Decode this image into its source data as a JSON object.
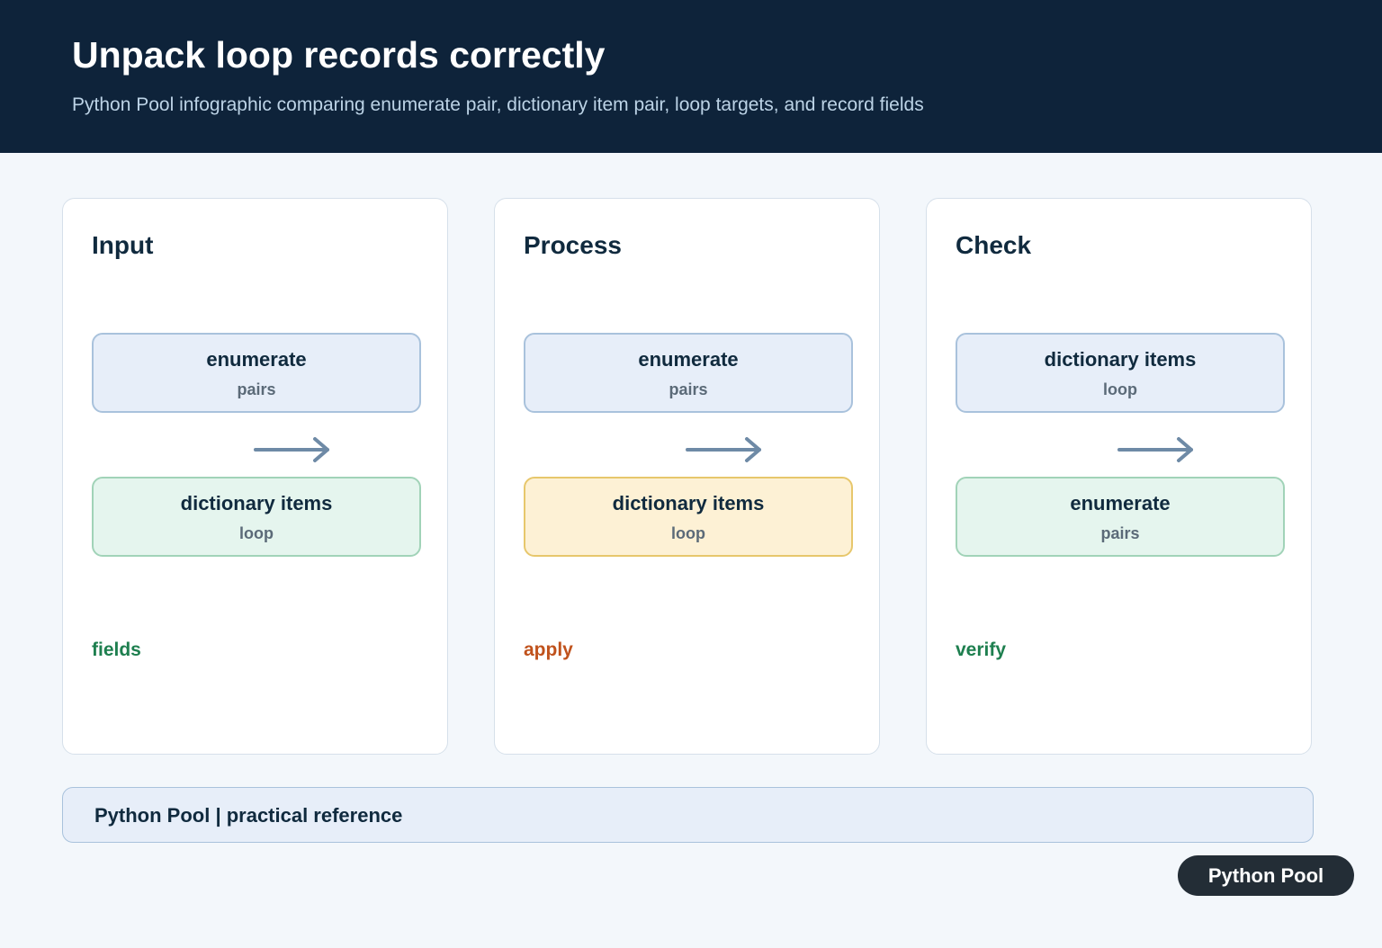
{
  "header": {
    "title": "Unpack loop records correctly",
    "subtitle": "Python Pool infographic comparing enumerate pair, dictionary item pair, loop targets, and record fields"
  },
  "panels": [
    {
      "title": "Input",
      "top_box": {
        "label": "enumerate",
        "sub": "pairs",
        "style": "blue"
      },
      "bottom_box": {
        "label": "dictionary items",
        "sub": "loop",
        "style": "green"
      },
      "step_label": "fields",
      "step_color": "#1e7f4f"
    },
    {
      "title": "Process",
      "top_box": {
        "label": "enumerate",
        "sub": "pairs",
        "style": "blue"
      },
      "bottom_box": {
        "label": "dictionary items",
        "sub": "loop",
        "style": "yellow"
      },
      "step_label": "apply",
      "step_color": "#c0521c"
    },
    {
      "title": "Check",
      "top_box": {
        "label": "dictionary items",
        "sub": "loop",
        "style": "blue"
      },
      "bottom_box": {
        "label": "enumerate",
        "sub": "pairs",
        "style": "green"
      },
      "step_label": "verify",
      "step_color": "#1e7f4f"
    }
  ],
  "footer": {
    "text": "Python Pool | practical reference"
  },
  "badge": {
    "text": "Python Pool"
  },
  "colors": {
    "header_bg": "#0e233a",
    "arrow": "#6e8aa6"
  },
  "icons": {
    "flow_arrow": "arrow-right-icon"
  }
}
